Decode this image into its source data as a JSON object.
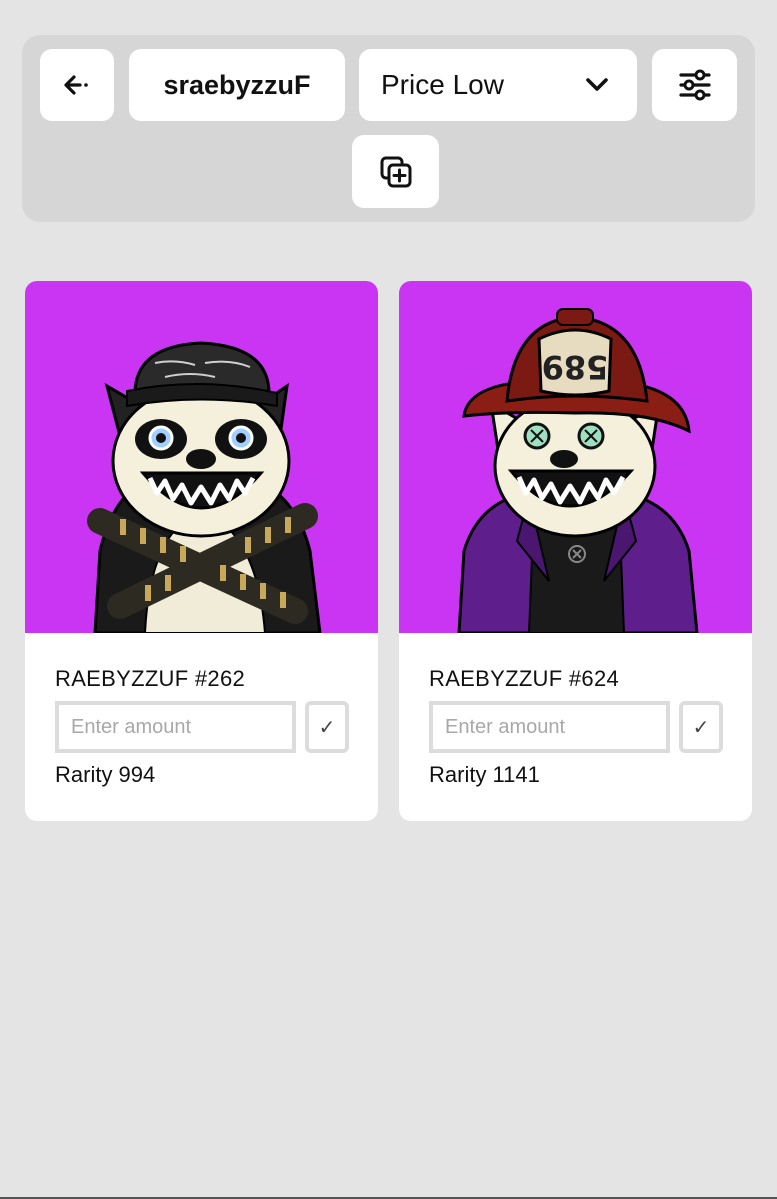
{
  "toolbar": {
    "back_icon": "arrow-left-icon",
    "collection_title": "sraebyzzuF",
    "sort": {
      "selected": "Price Low",
      "icon": "chevron-down-icon"
    },
    "filter_icon": "sliders-icon",
    "add_icon": "add-layers-icon"
  },
  "cards": [
    {
      "name": "RAEBYZZUF #262",
      "amount_placeholder": "Enter amount",
      "confirm_label": "✓",
      "rarity": "Rarity 994",
      "background": "#c935f3",
      "art_icon": "bear-with-cap-nft"
    },
    {
      "name": "RAEBYZZUF #624",
      "amount_placeholder": "Enter amount",
      "confirm_label": "✓",
      "rarity": "Rarity 1141",
      "background": "#c935f3",
      "art_icon": "bear-with-firefighter-helmet-nft"
    }
  ],
  "colors": {
    "page_bg": "#e4e4e4",
    "toolbar_bg": "#d6d6d6",
    "card_bg": "#ffffff",
    "art_bg": "#c935f3"
  }
}
